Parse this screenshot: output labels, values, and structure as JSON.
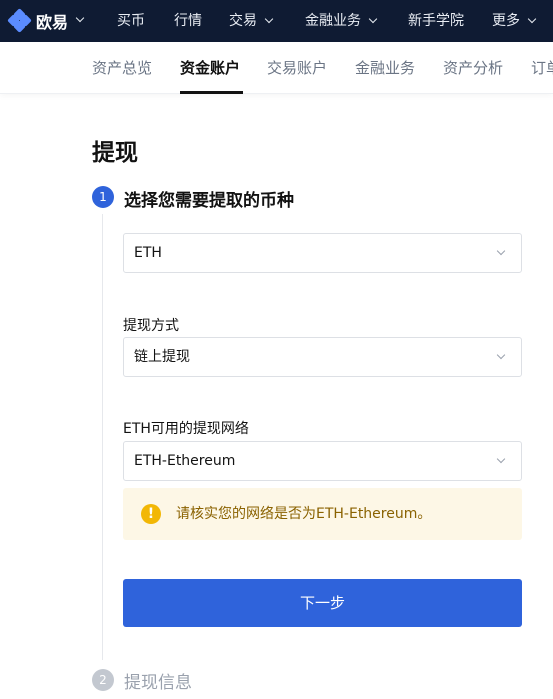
{
  "topnav": {
    "brand": "欧易",
    "items": [
      {
        "label": "买币",
        "chevron": false
      },
      {
        "label": "行情",
        "chevron": false
      },
      {
        "label": "交易",
        "chevron": true
      },
      {
        "label": "金融业务",
        "chevron": true
      },
      {
        "label": "新手学院",
        "chevron": false
      },
      {
        "label": "更多",
        "chevron": true
      }
    ]
  },
  "subnav": {
    "tabs": [
      "资产总览",
      "资金账户",
      "交易账户",
      "金融业务",
      "资产分析",
      "订单"
    ],
    "active_tab": "资金账户"
  },
  "page": {
    "title": "提现",
    "step1": {
      "number": "1",
      "label": "选择您需要提取的币种"
    },
    "coin_select": {
      "value": "ETH"
    },
    "method_label": "提现方式",
    "method_select": {
      "value": "链上提现"
    },
    "network_label": "ETH可用的提现网络",
    "network_select": {
      "value": "ETH-Ethereum"
    },
    "notice": {
      "icon": "!",
      "text": "请核实您的网络是否为ETH-Ethereum。"
    },
    "next_button": "下一步",
    "step2": {
      "number": "2",
      "label": "提现信息"
    }
  },
  "colors": {
    "topnav_bg": "#0f1b33",
    "primary": "#2f63db",
    "step_inactive": "#c3c8d0",
    "notice_bg": "#fdf7e6",
    "warning": "#f2b705"
  }
}
